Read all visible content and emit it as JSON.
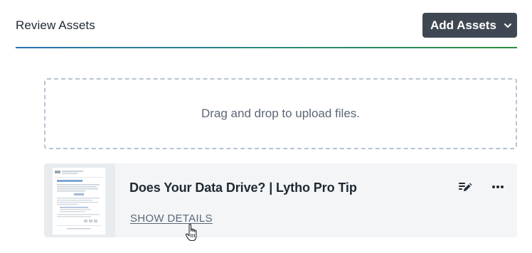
{
  "header": {
    "title": "Review Assets",
    "add_button_label": "Add Assets"
  },
  "dropzone": {
    "text": "Drag and drop to upload files."
  },
  "assets": [
    {
      "title": "Does Your Data Drive? | Lytho Pro Tip",
      "show_details_label": "SHOW DETAILS"
    }
  ],
  "icons": {
    "add_chevron": "chevron-down-icon",
    "edit": "edit-notes-icon",
    "more": "more-horizontal-icon",
    "cursor": "hand-pointer-icon"
  },
  "colors": {
    "button_bg": "#3f4852",
    "divider_start": "#2e6fb0",
    "divider_end": "#2e8a3e",
    "card_bg": "#f3f5f7",
    "dropzone_border": "#b8c4d0"
  }
}
